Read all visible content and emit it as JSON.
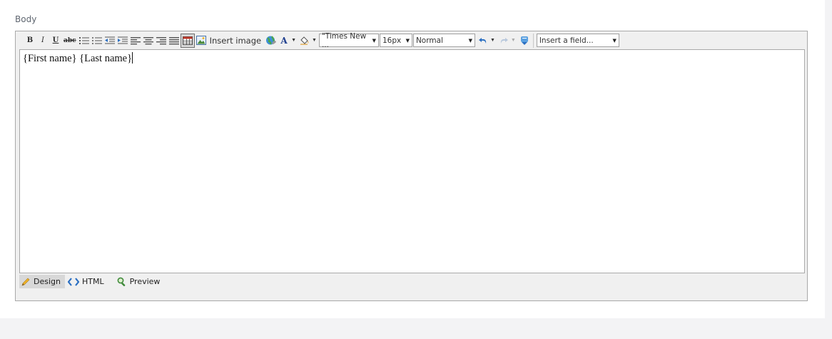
{
  "field": {
    "label": "Body"
  },
  "toolbar": {
    "bold": "B",
    "italic": "I",
    "underline": "U",
    "strike": "abc",
    "insert_image_label": "Insert image",
    "font_color_glyph": "A",
    "font_family": "\"Times New ...",
    "font_size": "16px",
    "paragraph_style": "Normal",
    "insert_field_placeholder": "Insert a field..."
  },
  "content": {
    "text": "{First name} {Last name}"
  },
  "modes": [
    {
      "label": "Design",
      "icon": "pencil-icon",
      "active": true
    },
    {
      "label": "HTML",
      "icon": "code-icon",
      "active": false
    },
    {
      "label": "Preview",
      "icon": "magnifier-icon",
      "active": false
    }
  ],
  "colors": {
    "accent_blue": "#2b6fc2",
    "border": "#a9a9a9",
    "toolbar_bg": "#f0f0f0"
  }
}
